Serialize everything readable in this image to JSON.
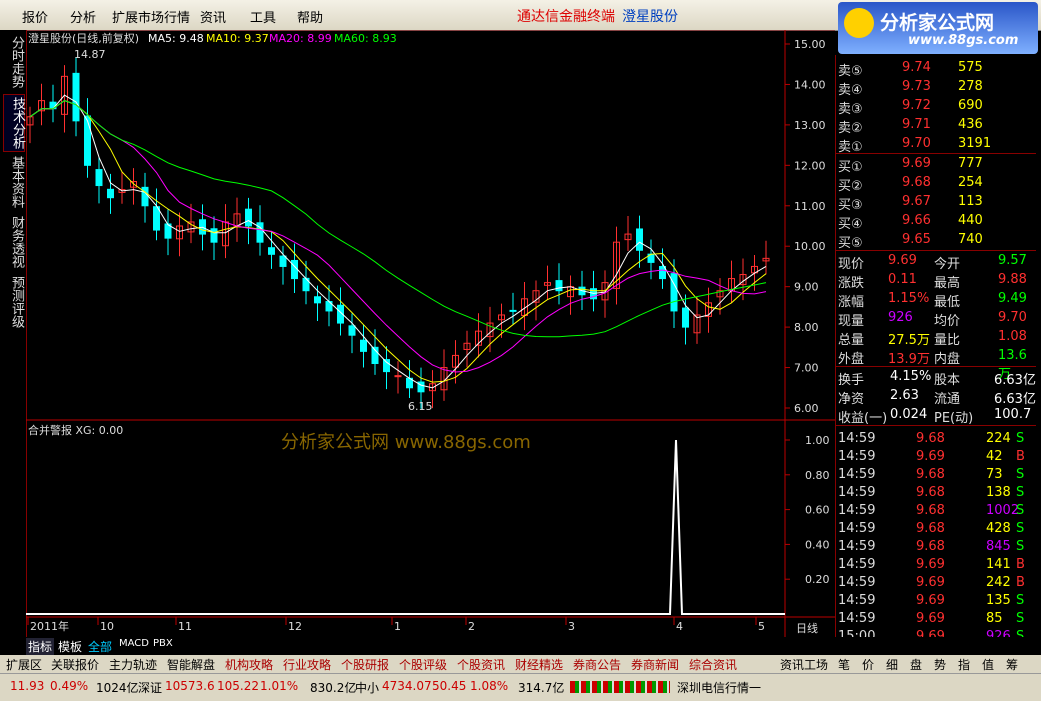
{
  "menu": {
    "items": [
      "报价",
      "分析",
      "扩展市场行情",
      "资讯",
      "工具",
      "帮助"
    ],
    "center_title": "通达信金融终端",
    "stock_name": "澄星股份"
  },
  "logo": {
    "title": "分析家公式网",
    "url": "www.88gs.com"
  },
  "left_tabs": [
    "分时走势",
    "技术分析",
    "基本资料",
    "财务透视",
    "预测评级"
  ],
  "main_chart": {
    "header": "澄星股份(日线,前复权)",
    "ma": [
      {
        "label": "MA5: 9.48",
        "color": "#ffffff"
      },
      {
        "label": "MA10: 9.37",
        "color": "#ffff00"
      },
      {
        "label": "MA20: 8.99",
        "color": "#ff00ff"
      },
      {
        "label": "MA60: 8.93",
        "color": "#00ff00"
      }
    ],
    "high_label": "14.87",
    "low_label": "6.15",
    "yticks": [
      "15.00",
      "14.00",
      "13.00",
      "12.00",
      "11.00",
      "10.00",
      "9.00",
      "8.00",
      "7.00",
      "6.00"
    ]
  },
  "sub_chart": {
    "header": "合并警报 XG: 0.00",
    "watermark": "分析家公式网 www.88gs.com",
    "yticks": [
      "1.00",
      "0.80",
      "0.60",
      "0.40",
      "0.20"
    ]
  },
  "xaxis": [
    "2011年",
    "10",
    "11",
    "12",
    "1",
    "2",
    "3",
    "4",
    "5"
  ],
  "period_label": "日线",
  "order_book": {
    "sells": [
      [
        "卖⑤",
        "9.74",
        "575"
      ],
      [
        "卖④",
        "9.73",
        "278"
      ],
      [
        "卖③",
        "9.72",
        "690"
      ],
      [
        "卖②",
        "9.71",
        "436"
      ],
      [
        "卖①",
        "9.70",
        "3191"
      ]
    ],
    "buys": [
      [
        "买①",
        "9.69",
        "777"
      ],
      [
        "买②",
        "9.68",
        "254"
      ],
      [
        "买③",
        "9.67",
        "113"
      ],
      [
        "买④",
        "9.66",
        "440"
      ],
      [
        "买⑤",
        "9.65",
        "740"
      ]
    ]
  },
  "quote": [
    [
      "现价",
      "9.69",
      "今开",
      "9.57"
    ],
    [
      "涨跌",
      "0.11",
      "最高",
      "9.88"
    ],
    [
      "涨幅",
      "1.15%",
      "最低",
      "9.49"
    ],
    [
      "现量",
      "926",
      "均价",
      "9.70"
    ],
    [
      "总量",
      "27.5万",
      "量比",
      "1.08"
    ],
    [
      "外盘",
      "13.9万",
      "内盘",
      "13.6万"
    ]
  ],
  "fundamentals": [
    [
      "换手",
      "4.15%",
      "股本",
      "6.63亿"
    ],
    [
      "净资",
      "2.63",
      "流通",
      "6.63亿"
    ],
    [
      "收益(一)",
      "0.024",
      "PE(动)",
      "100.7"
    ]
  ],
  "ticks": [
    [
      "14:59",
      "9.68",
      "224",
      "S"
    ],
    [
      "14:59",
      "9.69",
      "42",
      "B"
    ],
    [
      "14:59",
      "9.68",
      "73",
      "S"
    ],
    [
      "14:59",
      "9.68",
      "138",
      "S"
    ],
    [
      "14:59",
      "9.68",
      "1002",
      "S"
    ],
    [
      "14:59",
      "9.68",
      "428",
      "S"
    ],
    [
      "14:59",
      "9.68",
      "845",
      "S"
    ],
    [
      "14:59",
      "9.69",
      "141",
      "B"
    ],
    [
      "14:59",
      "9.69",
      "242",
      "B"
    ],
    [
      "14:59",
      "9.69",
      "135",
      "S"
    ],
    [
      "14:59",
      "9.69",
      "85",
      "S"
    ],
    [
      "15:00",
      "9.69",
      "926",
      "S"
    ]
  ],
  "indicator_tabs": [
    "指标",
    "模板",
    "全部",
    "MACD",
    "PBX"
  ],
  "func_tabs": [
    "扩展区",
    "关联报价",
    "主力轨迹",
    "智能解盘",
    "机构攻略",
    "行业攻略",
    "个股研报",
    "个股评级",
    "个股资讯",
    "财经精选",
    "券商公告",
    "券商新闻",
    "综合资讯"
  ],
  "right_tabs": [
    "资讯工场",
    "笔",
    "价",
    "细",
    "盘",
    "势",
    "指",
    "值",
    "筹"
  ],
  "status": {
    "idx1_val": "11.93",
    "idx1_pct": "0.49%",
    "idx1_amt": "1024亿",
    "sz_label": "深证",
    "sz_val": "10573.6",
    "sz_chg": "105.22",
    "sz_pct": "1.01%",
    "sz_amt": "830.2亿",
    "zx_label": "中小",
    "zx_val": "4734.07",
    "zx_chg": "50.45",
    "zx_pct": "1.08%",
    "zx_amt": "314.7亿",
    "feed": "深圳电信行情一"
  },
  "chart_data": {
    "type": "candlestick",
    "title": "澄星股份(日线,前复权)",
    "ylim": [
      6.0,
      15.2
    ],
    "x_labels": [
      "2011年",
      "10",
      "11",
      "12",
      "1",
      "2",
      "3",
      "4",
      "5"
    ],
    "ohlc_close_approx": [
      13.2,
      13.6,
      13.4,
      14.2,
      13.1,
      12.0,
      11.5,
      11.2,
      11.4,
      11.6,
      11.0,
      10.4,
      10.2,
      10.5,
      10.6,
      10.3,
      10.1,
      10.6,
      10.8,
      10.5,
      10.1,
      9.8,
      9.5,
      9.2,
      8.9,
      8.6,
      8.4,
      8.1,
      7.8,
      7.4,
      7.1,
      6.9,
      6.8,
      6.5,
      6.4,
      6.6,
      7.0,
      7.3,
      7.6,
      7.9,
      8.1,
      8.3,
      8.4,
      8.7,
      8.9,
      9.1,
      8.9,
      9.0,
      8.8,
      8.7,
      9.1,
      10.1,
      10.3,
      9.9,
      9.6,
      9.2,
      8.4,
      8.0,
      8.3,
      8.6,
      8.9,
      9.2,
      9.3,
      9.5,
      9.7
    ],
    "series": [
      {
        "name": "MA5",
        "value": 9.48
      },
      {
        "name": "MA10",
        "value": 9.37
      },
      {
        "name": "MA20",
        "value": 8.99
      },
      {
        "name": "MA60",
        "value": 8.93
      }
    ],
    "annotations": [
      "14.87",
      "6.15"
    ],
    "sub": {
      "name": "合并警报",
      "values_nonzero_near": "4",
      "peak": 1.0
    }
  }
}
